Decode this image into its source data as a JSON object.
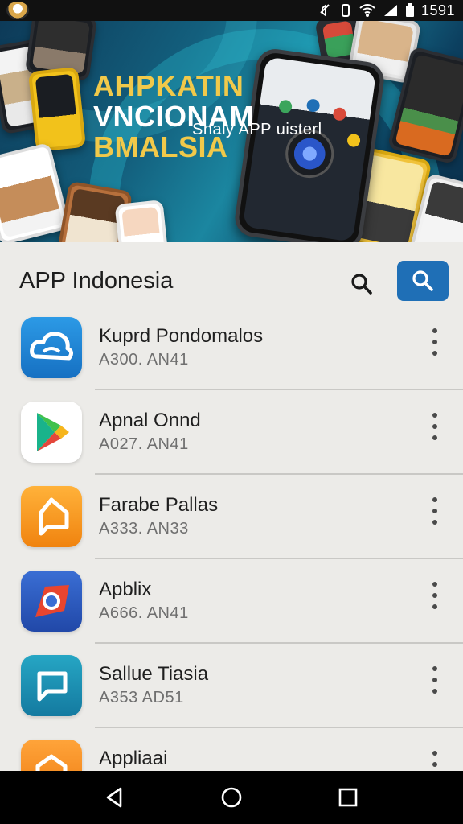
{
  "status_bar": {
    "time": "1591",
    "icons": [
      "app-badge-icon",
      "mute-icon",
      "wifi-icon",
      "signal-icon",
      "battery-icon"
    ]
  },
  "banner": {
    "headline_line1": "AHPKATIN",
    "headline_line2": "VNCIONAM",
    "headline_line3": "BMALSIA",
    "subtitle": "Shaly APP uisterl"
  },
  "app_bar": {
    "title": "APP Indonesia",
    "accent_color": "#1f6fb6"
  },
  "apps": [
    {
      "name": "Kuprd Pondomalos",
      "meta": "A300. AN41",
      "icon": "cloud-app-icon",
      "color": "#1f86d6"
    },
    {
      "name": "Apnal Onnd",
      "meta": "A027. AN41",
      "icon": "play-store-icon",
      "color": "#ffffff"
    },
    {
      "name": "Farabe Pallas",
      "meta": "A333. AN33",
      "icon": "orange-chat-icon",
      "color": "#f39a1e"
    },
    {
      "name": "Apblix",
      "meta": "A666. AN41",
      "icon": "chrome-like-icon",
      "color": "#2f5fc4"
    },
    {
      "name": "Sallue Tiasia",
      "meta": "A353 AD51",
      "icon": "teal-chat-icon",
      "color": "#1a8fb0"
    },
    {
      "name": "Appliaai",
      "meta": "",
      "icon": "orange-envelope-icon",
      "color": "#f08a1a"
    }
  ],
  "nav_bar": {
    "icons": [
      "back-icon",
      "home-icon",
      "recents-icon"
    ]
  }
}
